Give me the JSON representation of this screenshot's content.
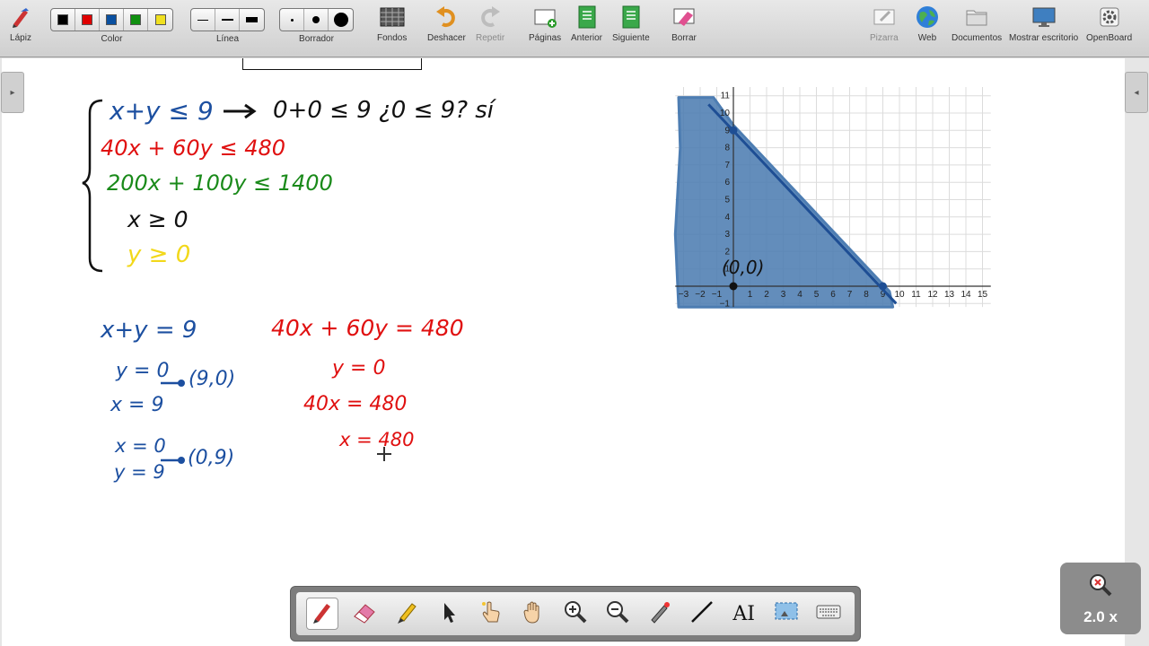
{
  "toolbar": {
    "pen": "Lápiz",
    "color": "Color",
    "line": "Línea",
    "eraser": "Borrador",
    "backgrounds": "Fondos",
    "undo": "Deshacer",
    "redo": "Repetir",
    "pages": "Páginas",
    "previous": "Anterior",
    "next": "Siguiente",
    "clear": "Borrar",
    "whiteboard": "Pizarra",
    "web": "Web",
    "documents": "Documentos",
    "show_desktop": "Mostrar escritorio",
    "openboard": "OpenBoard",
    "colors": [
      "#000000",
      "#e00000",
      "#0a50a0",
      "#109010",
      "#f0e020"
    ]
  },
  "board": {
    "system": {
      "eq1": "x+y ≤ 9",
      "check": "0+0 ≤ 9   ¿0 ≤ 9? sí",
      "eq2": "40x + 60y ≤ 480",
      "eq3": "200x + 100y ≤ 1400",
      "eq4": "x ≥ 0",
      "eq5": "y ≥ 0"
    },
    "work_left": {
      "line": "x+y = 9",
      "a1": "y = 0",
      "a2": "x = 9",
      "p1": "(9,0)",
      "b1": "x = 0",
      "b2": "y = 9",
      "p2": "(0,9)"
    },
    "work_right": {
      "line": "40x + 60y = 480",
      "a1": "y = 0",
      "a2": "40x = 480",
      "a3": "x = 480"
    },
    "point_label": "(0,0)"
  },
  "chart_data": {
    "type": "line",
    "title": "",
    "x_ticks": [
      -3,
      -2,
      -1,
      1,
      2,
      3,
      4,
      5,
      6,
      7,
      8,
      9,
      10,
      11,
      12,
      13,
      14,
      15
    ],
    "y_ticks": [
      -1,
      1,
      2,
      3,
      4,
      5,
      6,
      7,
      8,
      9,
      10,
      11
    ],
    "xlim": [
      -3.5,
      15.5
    ],
    "ylim": [
      -1.2,
      11.5
    ],
    "series": [
      {
        "values": [
          [
            -1.5,
            10.5
          ],
          [
            9.8,
            -1
          ]
        ]
      }
    ],
    "points": [
      [
        0,
        9
      ],
      [
        9,
        0
      ],
      [
        0,
        0
      ]
    ],
    "shaded_region": "below line x+y=9",
    "grid": true,
    "line_color": "#1e4e94",
    "fill_color": "#4d7db2"
  },
  "zoom": {
    "label": "2.0 x"
  }
}
